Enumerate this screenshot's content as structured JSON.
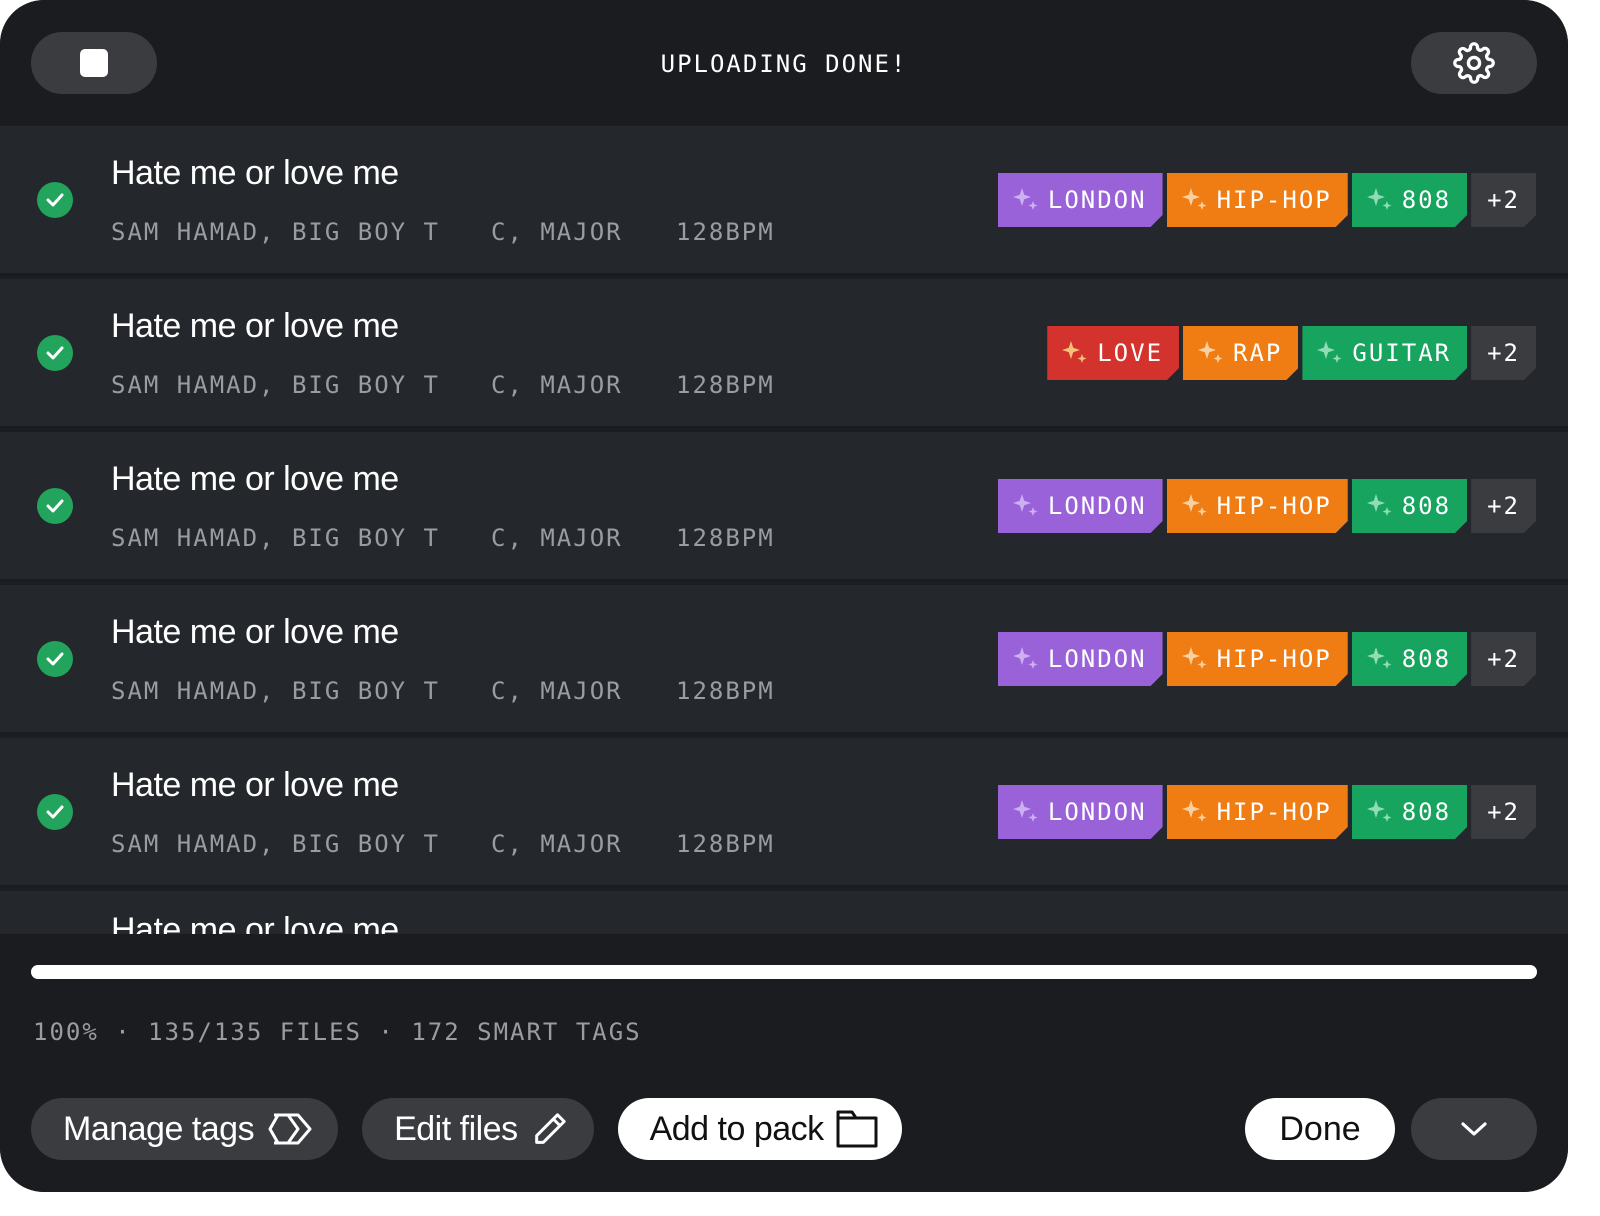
{
  "header": {
    "title": "UPLOADING DONE!"
  },
  "colors": {
    "purple": "#9a62d9",
    "orange": "#f07d13",
    "green": "#16a45f",
    "red": "#d3322d",
    "check": "#22a45d"
  },
  "rows": [
    {
      "title": "Hate me or love me",
      "artist": "SAM HAMAD, BIG BOY T",
      "key": "C, MAJOR",
      "bpm": "128BPM",
      "tags": [
        {
          "label": "LONDON",
          "color": "purple"
        },
        {
          "label": "HIP-HOP",
          "color": "orange"
        },
        {
          "label": "808",
          "color": "green"
        }
      ],
      "more": "+2"
    },
    {
      "title": "Hate me or love me",
      "artist": "SAM HAMAD, BIG BOY T",
      "key": "C, MAJOR",
      "bpm": "128BPM",
      "tags": [
        {
          "label": "LOVE",
          "color": "red"
        },
        {
          "label": "RAP",
          "color": "orange"
        },
        {
          "label": "GUITAR",
          "color": "green"
        }
      ],
      "more": "+2"
    },
    {
      "title": "Hate me or love me",
      "artist": "SAM HAMAD, BIG BOY T",
      "key": "C, MAJOR",
      "bpm": "128BPM",
      "tags": [
        {
          "label": "LONDON",
          "color": "purple"
        },
        {
          "label": "HIP-HOP",
          "color": "orange"
        },
        {
          "label": "808",
          "color": "green"
        }
      ],
      "more": "+2"
    },
    {
      "title": "Hate me or love me",
      "artist": "SAM HAMAD, BIG BOY T",
      "key": "C, MAJOR",
      "bpm": "128BPM",
      "tags": [
        {
          "label": "LONDON",
          "color": "purple"
        },
        {
          "label": "HIP-HOP",
          "color": "orange"
        },
        {
          "label": "808",
          "color": "green"
        }
      ],
      "more": "+2"
    },
    {
      "title": "Hate me or love me",
      "artist": "SAM HAMAD, BIG BOY T",
      "key": "C, MAJOR",
      "bpm": "128BPM",
      "tags": [
        {
          "label": "LONDON",
          "color": "purple"
        },
        {
          "label": "HIP-HOP",
          "color": "orange"
        },
        {
          "label": "808",
          "color": "green"
        }
      ],
      "more": "+2"
    },
    {
      "title": "Hate me or love me"
    }
  ],
  "progress": {
    "percent": 100
  },
  "status": {
    "text": "100% · 135/135 FILES · 172 SMART TAGS"
  },
  "actions": {
    "manage_tags": "Manage tags",
    "edit_files": "Edit files",
    "add_to_pack": "Add to pack",
    "done": "Done"
  }
}
